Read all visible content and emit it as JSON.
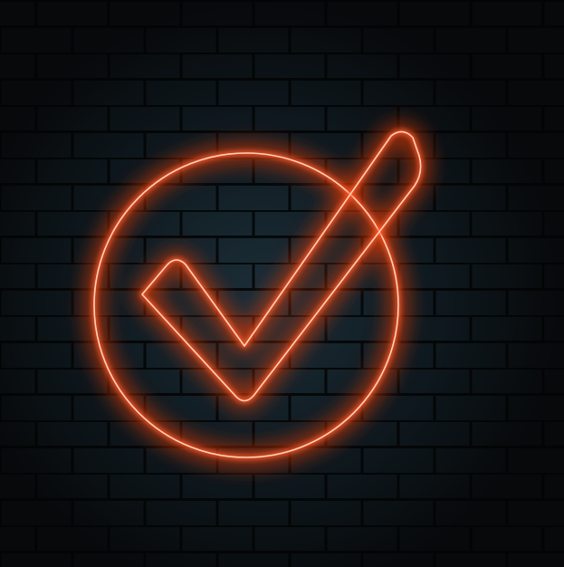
{
  "scene": {
    "subject": "neon-checkmark-in-circle",
    "background": "dark-brick-wall",
    "colors": {
      "neon": "#ff5a2a",
      "neon_core": "#ffd2b8",
      "glow": "#ff3d00",
      "wall_dark": "#07090b",
      "wall_lit": "#1c2e38",
      "mortar": "#020304"
    }
  }
}
